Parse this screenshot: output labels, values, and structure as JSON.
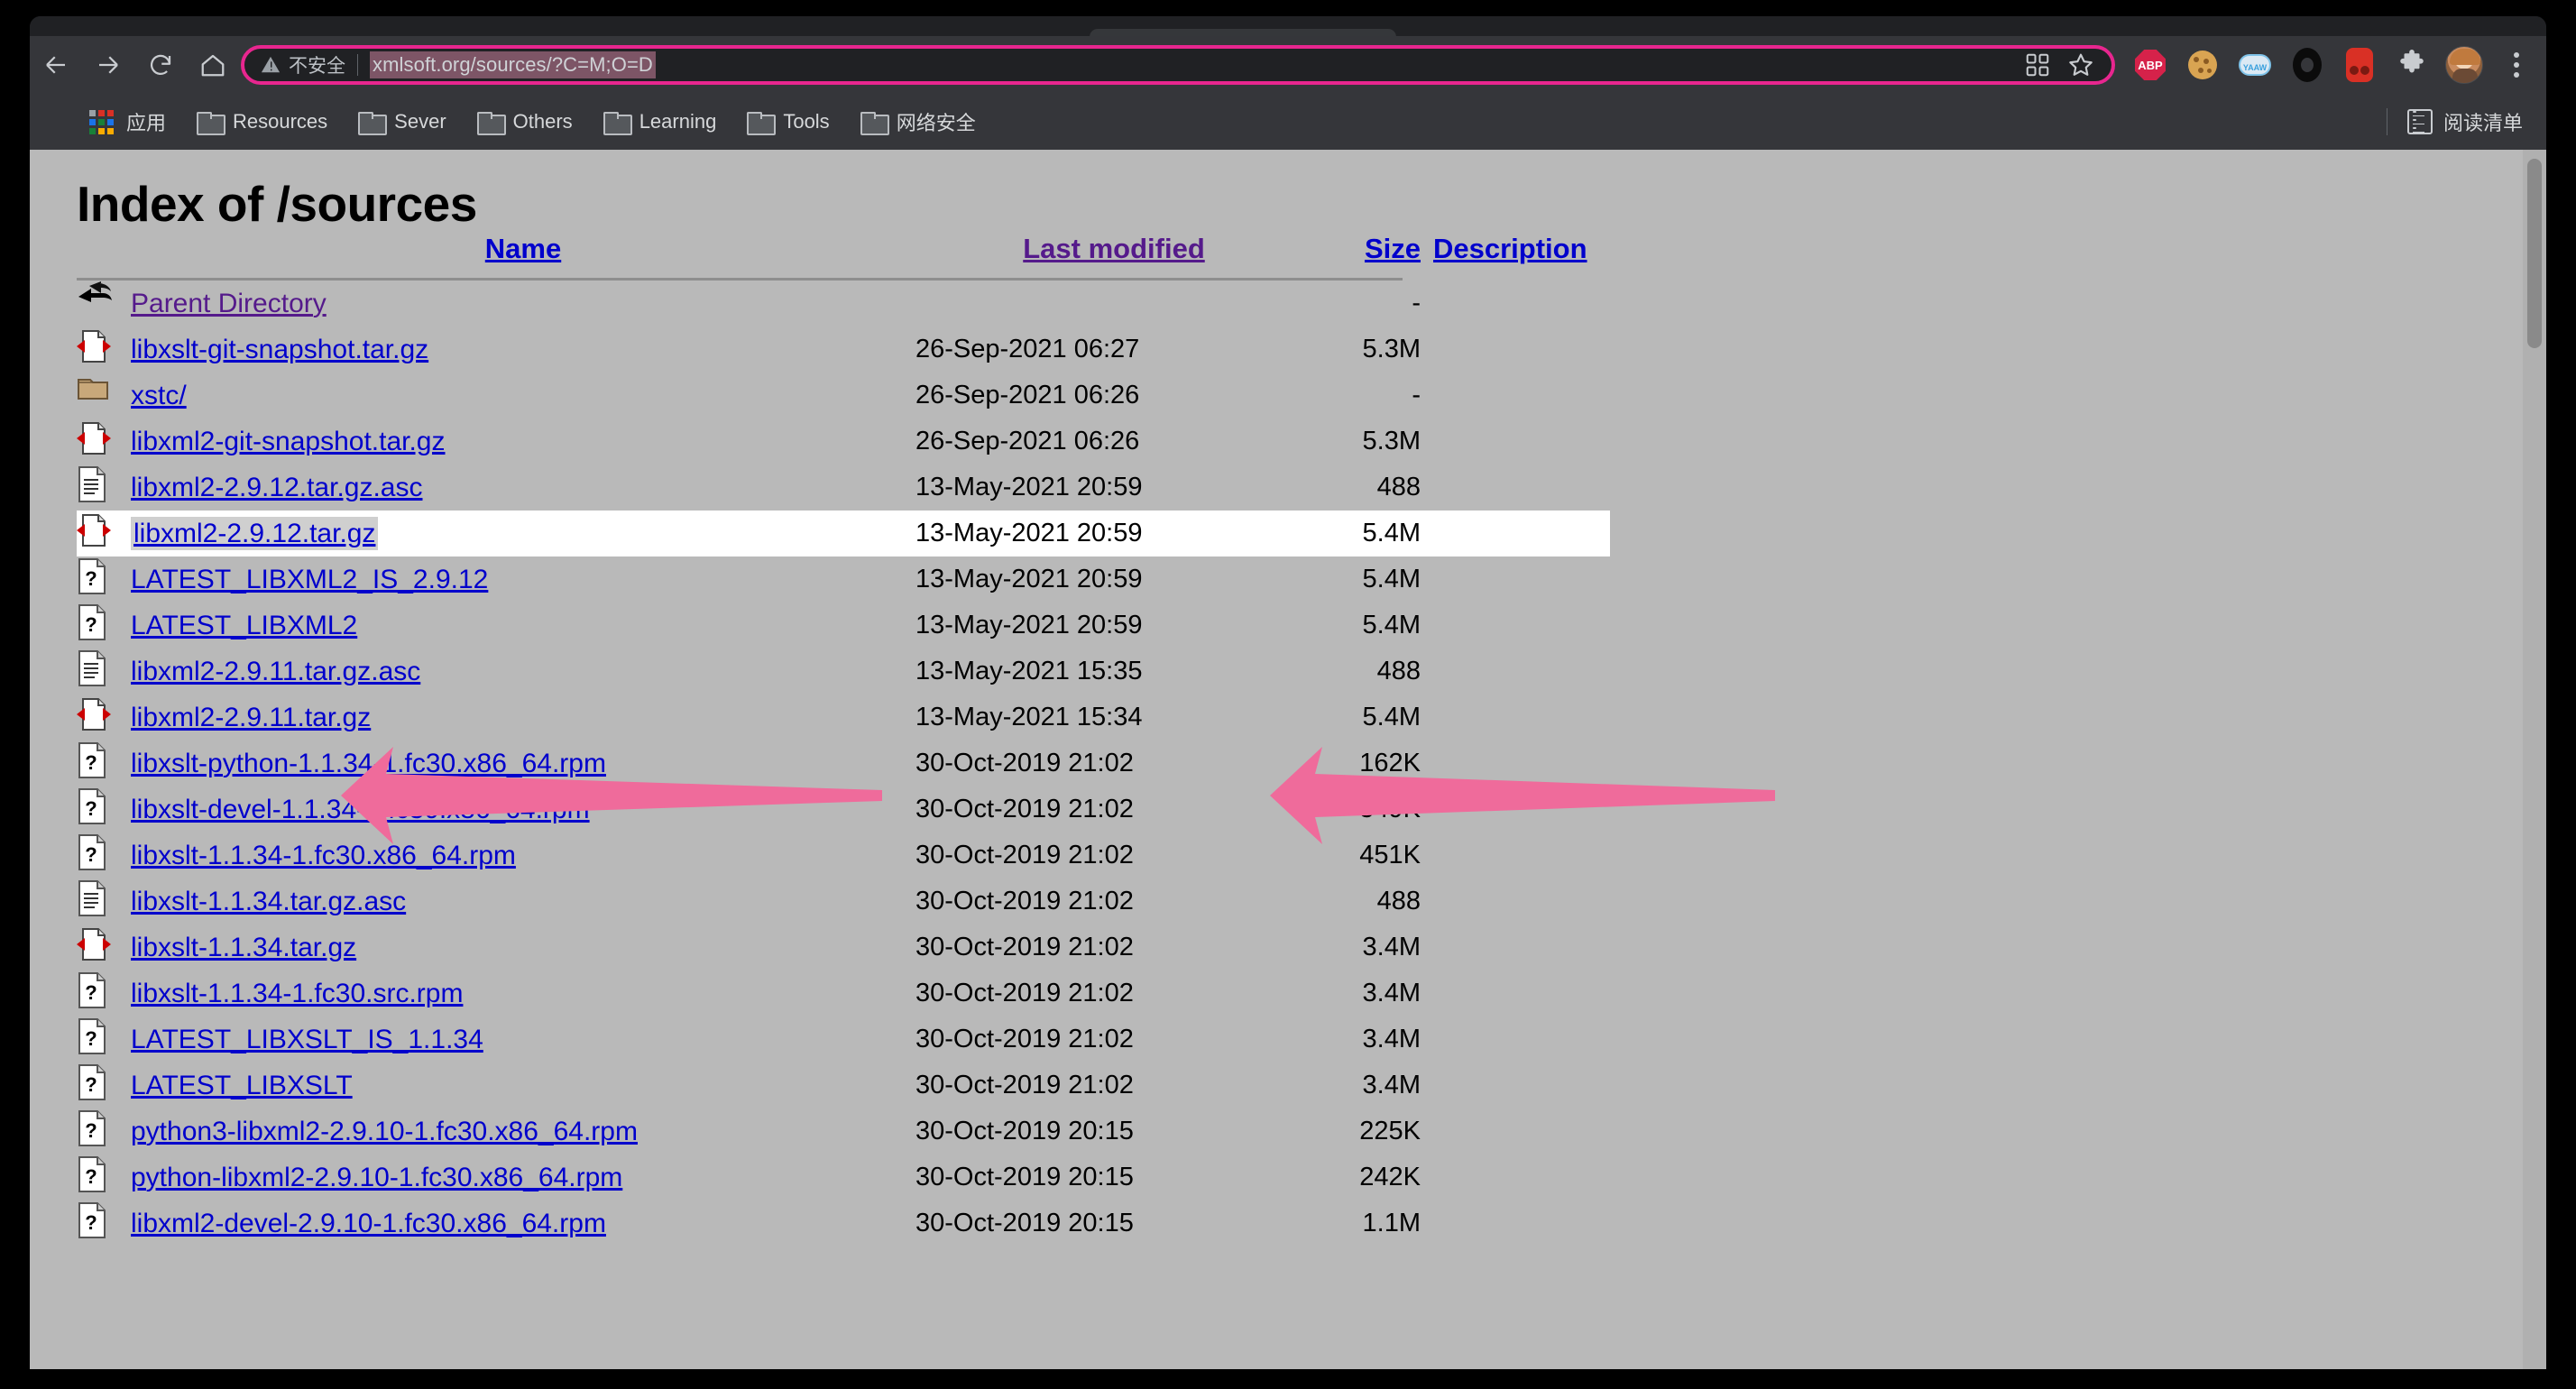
{
  "browser": {
    "nav": {
      "back_label": "Back",
      "forward_label": "Forward",
      "reload_label": "Reload",
      "home_label": "Home"
    },
    "omnibox": {
      "security_warning": "不安全",
      "security_icon": "warning-triangle-icon",
      "url": "xmlsoft.org/sources/?C=M;O=D",
      "url_selected": true,
      "qr_icon": "qr-code-icon",
      "bookmark_icon": "star-icon",
      "accent": "#e8268f"
    },
    "extensions": [
      {
        "name": "adblock-plus",
        "label": "ABP"
      },
      {
        "name": "cookie-manager",
        "label": ""
      },
      {
        "name": "yaaw-cloud",
        "label": "YAAW"
      },
      {
        "name": "ring-extension",
        "label": ""
      },
      {
        "name": "red-extension",
        "label": ""
      },
      {
        "name": "extensions-puzzle",
        "label": ""
      }
    ],
    "profile": {
      "name": "avatar"
    },
    "menu": {
      "name": "kebab-menu"
    },
    "bookmarks": [
      {
        "icon": "apps-grid-icon",
        "label": "应用"
      },
      {
        "icon": "folder-icon",
        "label": "Resources"
      },
      {
        "icon": "folder-icon",
        "label": "Sever"
      },
      {
        "icon": "folder-icon",
        "label": "Others"
      },
      {
        "icon": "folder-icon",
        "label": "Learning"
      },
      {
        "icon": "folder-icon",
        "label": "Tools"
      },
      {
        "icon": "folder-icon",
        "label": "网络安全"
      }
    ],
    "reading_list": {
      "icon": "reading-list-icon",
      "label": "阅读清单"
    }
  },
  "page": {
    "title": "Index of /sources",
    "headers": {
      "name": "Name",
      "last_modified": "Last modified",
      "size": "Size",
      "description": "Description"
    },
    "rows": [
      {
        "icon": "parent-directory-icon",
        "name": "Parent Directory",
        "modified": "",
        "size": "-",
        "visited": true
      },
      {
        "icon": "compressed-file-icon",
        "name": "libxslt-git-snapshot.tar.gz",
        "modified": "26-Sep-2021 06:27",
        "size": "5.3M"
      },
      {
        "icon": "folder-icon",
        "name": "xstc/",
        "modified": "26-Sep-2021 06:26",
        "size": "-"
      },
      {
        "icon": "compressed-file-icon",
        "name": "libxml2-git-snapshot.tar.gz",
        "modified": "26-Sep-2021 06:26",
        "size": "5.3M"
      },
      {
        "icon": "text-file-icon",
        "name": "libxml2-2.9.12.tar.gz.asc",
        "modified": "13-May-2021 20:59",
        "size": "488"
      },
      {
        "icon": "compressed-file-icon",
        "name": "libxml2-2.9.12.tar.gz",
        "modified": "13-May-2021 20:59",
        "size": "5.4M",
        "selected": true
      },
      {
        "icon": "unknown-file-icon",
        "name": "LATEST_LIBXML2_IS_2.9.12",
        "modified": "13-May-2021 20:59",
        "size": "5.4M"
      },
      {
        "icon": "unknown-file-icon",
        "name": "LATEST_LIBXML2",
        "modified": "13-May-2021 20:59",
        "size": "5.4M"
      },
      {
        "icon": "text-file-icon",
        "name": "libxml2-2.9.11.tar.gz.asc",
        "modified": "13-May-2021 15:35",
        "size": "488"
      },
      {
        "icon": "compressed-file-icon",
        "name": "libxml2-2.9.11.tar.gz",
        "modified": "13-May-2021 15:34",
        "size": "5.4M"
      },
      {
        "icon": "unknown-file-icon",
        "name": "libxslt-python-1.1.34-1.fc30.x86_64.rpm",
        "modified": "30-Oct-2019 21:02",
        "size": "162K"
      },
      {
        "icon": "unknown-file-icon",
        "name": "libxslt-devel-1.1.34-1.fc30.x86_64.rpm",
        "modified": "30-Oct-2019 21:02",
        "size": "549K"
      },
      {
        "icon": "unknown-file-icon",
        "name": "libxslt-1.1.34-1.fc30.x86_64.rpm",
        "modified": "30-Oct-2019 21:02",
        "size": "451K"
      },
      {
        "icon": "text-file-icon",
        "name": "libxslt-1.1.34.tar.gz.asc",
        "modified": "30-Oct-2019 21:02",
        "size": "488"
      },
      {
        "icon": "compressed-file-icon",
        "name": "libxslt-1.1.34.tar.gz",
        "modified": "30-Oct-2019 21:02",
        "size": "3.4M"
      },
      {
        "icon": "unknown-file-icon",
        "name": "libxslt-1.1.34-1.fc30.src.rpm",
        "modified": "30-Oct-2019 21:02",
        "size": "3.4M"
      },
      {
        "icon": "unknown-file-icon",
        "name": "LATEST_LIBXSLT_IS_1.1.34",
        "modified": "30-Oct-2019 21:02",
        "size": "3.4M"
      },
      {
        "icon": "unknown-file-icon",
        "name": "LATEST_LIBXSLT",
        "modified": "30-Oct-2019 21:02",
        "size": "3.4M"
      },
      {
        "icon": "unknown-file-icon",
        "name": "python3-libxml2-2.9.10-1.fc30.x86_64.rpm",
        "modified": "30-Oct-2019 20:15",
        "size": "225K"
      },
      {
        "icon": "unknown-file-icon",
        "name": "python-libxml2-2.9.10-1.fc30.x86_64.rpm",
        "modified": "30-Oct-2019 20:15",
        "size": "242K"
      },
      {
        "icon": "unknown-file-icon",
        "name": "libxml2-devel-2.9.10-1.fc30.x86_64.rpm",
        "modified": "30-Oct-2019 20:15",
        "size": "1.1M"
      }
    ]
  },
  "annotations": {
    "arrow_color": "#ef6b9b",
    "arrows": [
      {
        "name": "annotation-arrow-left",
        "points_to": "libxml2-2.9.12.tar.gz"
      },
      {
        "name": "annotation-arrow-right",
        "points_to": "13-May-2021 20:59 5.4M"
      }
    ]
  }
}
